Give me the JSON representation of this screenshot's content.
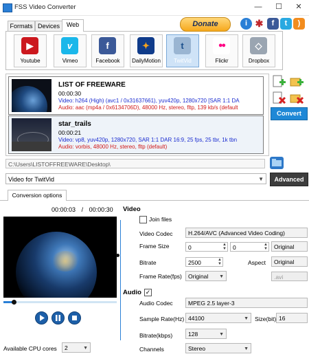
{
  "window": {
    "title": "FSS Video Converter",
    "min": "—",
    "max": "☐",
    "close": "✕"
  },
  "tabs": [
    {
      "label": "Formats"
    },
    {
      "label": "Devices"
    },
    {
      "label": "Web"
    }
  ],
  "sites": [
    {
      "label": "Youtube",
      "color": "#cc181e",
      "glyph": "▶"
    },
    {
      "label": "Vimeo",
      "color": "#1ab7ea",
      "glyph": "v"
    },
    {
      "label": "Facebook",
      "color": "#3b5998",
      "glyph": "f"
    },
    {
      "label": "DailyMotion",
      "color": "#0f3b8a",
      "glyph": "✦"
    },
    {
      "label": "TwitVid",
      "color": "#9ab5d2",
      "glyph": "t"
    },
    {
      "label": "Flickr",
      "color": "#ffffff",
      "glyph": "●●"
    },
    {
      "label": "Dropbox",
      "color": "#9aa5b1",
      "glyph": "◇"
    }
  ],
  "donate": {
    "label": "Donate"
  },
  "social": [
    {
      "icon": "info-icon",
      "glyph": "i",
      "color": "#2a7fd6"
    },
    {
      "icon": "bug-icon",
      "glyph": "✱",
      "color": "#c0272d"
    },
    {
      "icon": "facebook-icon",
      "glyph": "f",
      "color": "#3b5998"
    },
    {
      "icon": "twitter-icon",
      "glyph": "t",
      "color": "#29a9e1"
    },
    {
      "icon": "rss-icon",
      "glyph": ")",
      "color": "#f28c1e"
    }
  ],
  "files": [
    {
      "name": "LIST OF FREEWARE",
      "duration": "00:00:30",
      "video": "Video: h264 (High) (avc1 / 0x31637661), yuv420p, 1280x720 [SAR 1:1 DA",
      "audio": "Audio: aac (mp4a / 0x6134706D), 48000 Hz, stereo, fltp, 139 kb/s (default"
    },
    {
      "name": "star_trails",
      "duration": "00:00:21",
      "video": "Video: vp8, yuv420p, 1280x720, SAR 1:1 DAR 16:9, 25 fps, 25 tbr, 1k tbn",
      "audio": "Audio: vorbis, 48000 Hz, stereo, fltp (default)"
    }
  ],
  "convert": {
    "label": "Convert"
  },
  "output_path": "C:\\Users\\LISTOFFREEWARE\\Desktop\\",
  "profile": {
    "value": "Video for TwitVid"
  },
  "advanced": {
    "label": "Advanced"
  },
  "options_tab": {
    "label": "Conversion options"
  },
  "player": {
    "current": "00:00:03",
    "separator": "/",
    "total": "00:00:30",
    "progress": 0.09
  },
  "video": {
    "section": "Video",
    "join_files": "Join files",
    "codec_label": "Video Codec",
    "codec_value": "H.264/AVC (Advanced Video Coding)",
    "frame_size_label": "Frame Size",
    "width": "0",
    "height": "0",
    "size_mode": "Original",
    "bitrate_label": "Bitrate",
    "bitrate": "2500",
    "aspect_label": "Aspect",
    "aspect": "Original",
    "framerate_label": "Frame Rate(fps)",
    "framerate": "Original",
    "extension": ".avi"
  },
  "audio": {
    "section": "Audio",
    "checked": true,
    "codec_label": "Audio Codec",
    "codec_value": "MPEG 2.5 layer-3",
    "samplerate_label": "Sample Rate(Hz)",
    "samplerate": "44100",
    "size_label": "Size(bit)",
    "size": "16",
    "bitrate_label": "Bitrate(kbps)",
    "bitrate": "128",
    "channels_label": "Channels",
    "channels": "Stereo"
  },
  "cpu": {
    "label": "Available CPU cores",
    "value": "2"
  }
}
